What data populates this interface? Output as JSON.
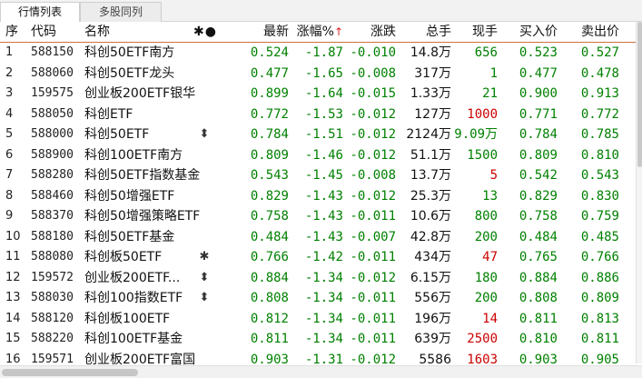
{
  "tabs": [
    {
      "label": "行情列表",
      "active": true
    },
    {
      "label": "多股同列",
      "active": false
    }
  ],
  "header": {
    "idx": "序",
    "code": "代码",
    "name": "名称",
    "tools": "✱●",
    "last": "最新",
    "pct": "涨幅%",
    "sort_indicator": "↑",
    "chg": "涨跌",
    "vol": "总手",
    "cur": "现手",
    "bid": "买入价",
    "ask": "卖出价"
  },
  "colors": {
    "up": "#cc0000",
    "down": "#008000",
    "selected_line": "#d07040"
  },
  "rows": [
    {
      "idx": "1",
      "code": "588150",
      "name": "科创50ETF南方",
      "flag": "",
      "last": "0.524",
      "pct": "-1.87",
      "chg": "-0.010",
      "vol": "14.8万",
      "cur": "656",
      "cur_color": "g",
      "bid": "0.523",
      "ask": "0.527"
    },
    {
      "idx": "2",
      "code": "588060",
      "name": "科创50ETF龙头",
      "flag": "",
      "last": "0.477",
      "pct": "-1.65",
      "chg": "-0.008",
      "vol": "317万",
      "cur": "1",
      "cur_color": "g",
      "bid": "0.477",
      "ask": "0.478"
    },
    {
      "idx": "3",
      "code": "159575",
      "name": "创业板200ETF银华",
      "flag": "",
      "last": "0.899",
      "pct": "-1.64",
      "chg": "-0.015",
      "vol": "1.33万",
      "cur": "21",
      "cur_color": "g",
      "bid": "0.900",
      "ask": "0.913"
    },
    {
      "idx": "4",
      "code": "588050",
      "name": "科创ETF",
      "flag": "",
      "last": "0.772",
      "pct": "-1.53",
      "chg": "-0.012",
      "vol": "127万",
      "cur": "1000",
      "cur_color": "r",
      "bid": "0.771",
      "ask": "0.772"
    },
    {
      "idx": "5",
      "code": "588000",
      "name": "科创50ETF",
      "flag": "⬍",
      "last": "0.784",
      "pct": "-1.51",
      "chg": "-0.012",
      "vol": "2124万",
      "cur": "9.09万",
      "cur_color": "g",
      "bid": "0.784",
      "ask": "0.785"
    },
    {
      "idx": "6",
      "code": "588900",
      "name": "科创100ETF南方",
      "flag": "",
      "last": "0.809",
      "pct": "-1.46",
      "chg": "-0.012",
      "vol": "51.1万",
      "cur": "1500",
      "cur_color": "g",
      "bid": "0.809",
      "ask": "0.810"
    },
    {
      "idx": "7",
      "code": "588280",
      "name": "科创50ETF指数基金",
      "flag": "",
      "last": "0.543",
      "pct": "-1.45",
      "chg": "-0.008",
      "vol": "13.7万",
      "cur": "5",
      "cur_color": "r",
      "bid": "0.542",
      "ask": "0.543"
    },
    {
      "idx": "8",
      "code": "588460",
      "name": "科创50增强ETF",
      "flag": "",
      "last": "0.829",
      "pct": "-1.43",
      "chg": "-0.012",
      "vol": "25.3万",
      "cur": "13",
      "cur_color": "g",
      "bid": "0.829",
      "ask": "0.830"
    },
    {
      "idx": "9",
      "code": "588370",
      "name": "科创50增强策略ETF",
      "flag": "",
      "last": "0.758",
      "pct": "-1.43",
      "chg": "-0.011",
      "vol": "10.6万",
      "cur": "800",
      "cur_color": "g",
      "bid": "0.758",
      "ask": "0.759"
    },
    {
      "idx": "10",
      "code": "588180",
      "name": "科创50ETF基金",
      "flag": "",
      "last": "0.484",
      "pct": "-1.43",
      "chg": "-0.007",
      "vol": "42.8万",
      "cur": "200",
      "cur_color": "g",
      "bid": "0.484",
      "ask": "0.485"
    },
    {
      "idx": "11",
      "code": "588080",
      "name": "科创板50ETF",
      "flag": "✱",
      "last": "0.766",
      "pct": "-1.42",
      "chg": "-0.011",
      "vol": "434万",
      "cur": "47",
      "cur_color": "r",
      "bid": "0.765",
      "ask": "0.766"
    },
    {
      "idx": "12",
      "code": "159572",
      "name": "创业板200ETF...",
      "flag": "⬍",
      "last": "0.884",
      "pct": "-1.34",
      "chg": "-0.012",
      "vol": "6.15万",
      "cur": "180",
      "cur_color": "g",
      "bid": "0.884",
      "ask": "0.886"
    },
    {
      "idx": "13",
      "code": "588030",
      "name": "科创100指数ETF",
      "flag": "⬍",
      "last": "0.808",
      "pct": "-1.34",
      "chg": "-0.011",
      "vol": "556万",
      "cur": "200",
      "cur_color": "g",
      "bid": "0.808",
      "ask": "0.809"
    },
    {
      "idx": "14",
      "code": "588120",
      "name": "科创板100ETF",
      "flag": "",
      "last": "0.812",
      "pct": "-1.34",
      "chg": "-0.011",
      "vol": "196万",
      "cur": "14",
      "cur_color": "r",
      "bid": "0.811",
      "ask": "0.813"
    },
    {
      "idx": "15",
      "code": "588220",
      "name": "科创100ETF基金",
      "flag": "",
      "last": "0.811",
      "pct": "-1.34",
      "chg": "-0.011",
      "vol": "639万",
      "cur": "2500",
      "cur_color": "r",
      "bid": "0.810",
      "ask": "0.811"
    },
    {
      "idx": "16",
      "code": "159571",
      "name": "创业板200ETF富国",
      "flag": "",
      "last": "0.903",
      "pct": "-1.31",
      "chg": "-0.012",
      "vol": "5586",
      "cur": "1603",
      "cur_color": "r",
      "bid": "0.903",
      "ask": "0.905"
    }
  ]
}
